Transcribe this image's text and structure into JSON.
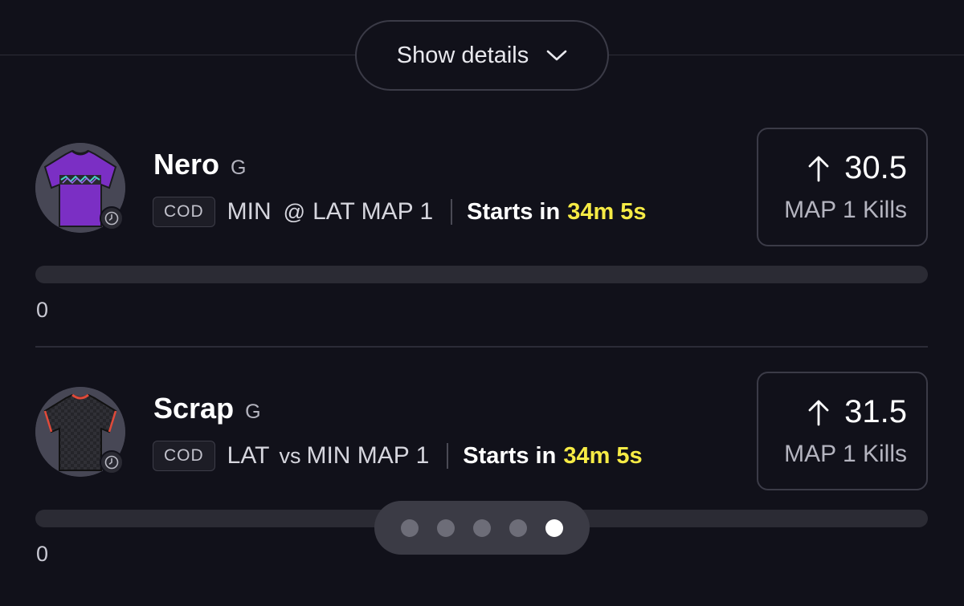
{
  "header": {
    "show_details_label": "Show details"
  },
  "picks": [
    {
      "player": "Nero",
      "position": "G",
      "league": "COD",
      "team": "MIN",
      "separator": "@",
      "matchup_rest": "LAT MAP 1",
      "starts_label": "Starts in",
      "starts_time": "34m 5s",
      "line_value": "30.5",
      "stat_label": "MAP 1 Kills",
      "progress_value": "0",
      "progress_fraction": 0,
      "jersey_icon": "purple-jersey-icon"
    },
    {
      "player": "Scrap",
      "position": "G",
      "league": "COD",
      "team": "LAT",
      "separator": "vs",
      "matchup_rest": "MIN MAP 1",
      "starts_label": "Starts in",
      "starts_time": "34m 5s",
      "line_value": "31.5",
      "stat_label": "MAP 1 Kills",
      "progress_value": "0",
      "progress_fraction": 0,
      "jersey_icon": "black-jersey-icon"
    }
  ],
  "pager": {
    "total": 5,
    "active_index": 4
  },
  "colors": {
    "background": "#11111a",
    "highlight": "#f6eb45",
    "track": "#2b2b34",
    "border": "#3b3b47"
  }
}
